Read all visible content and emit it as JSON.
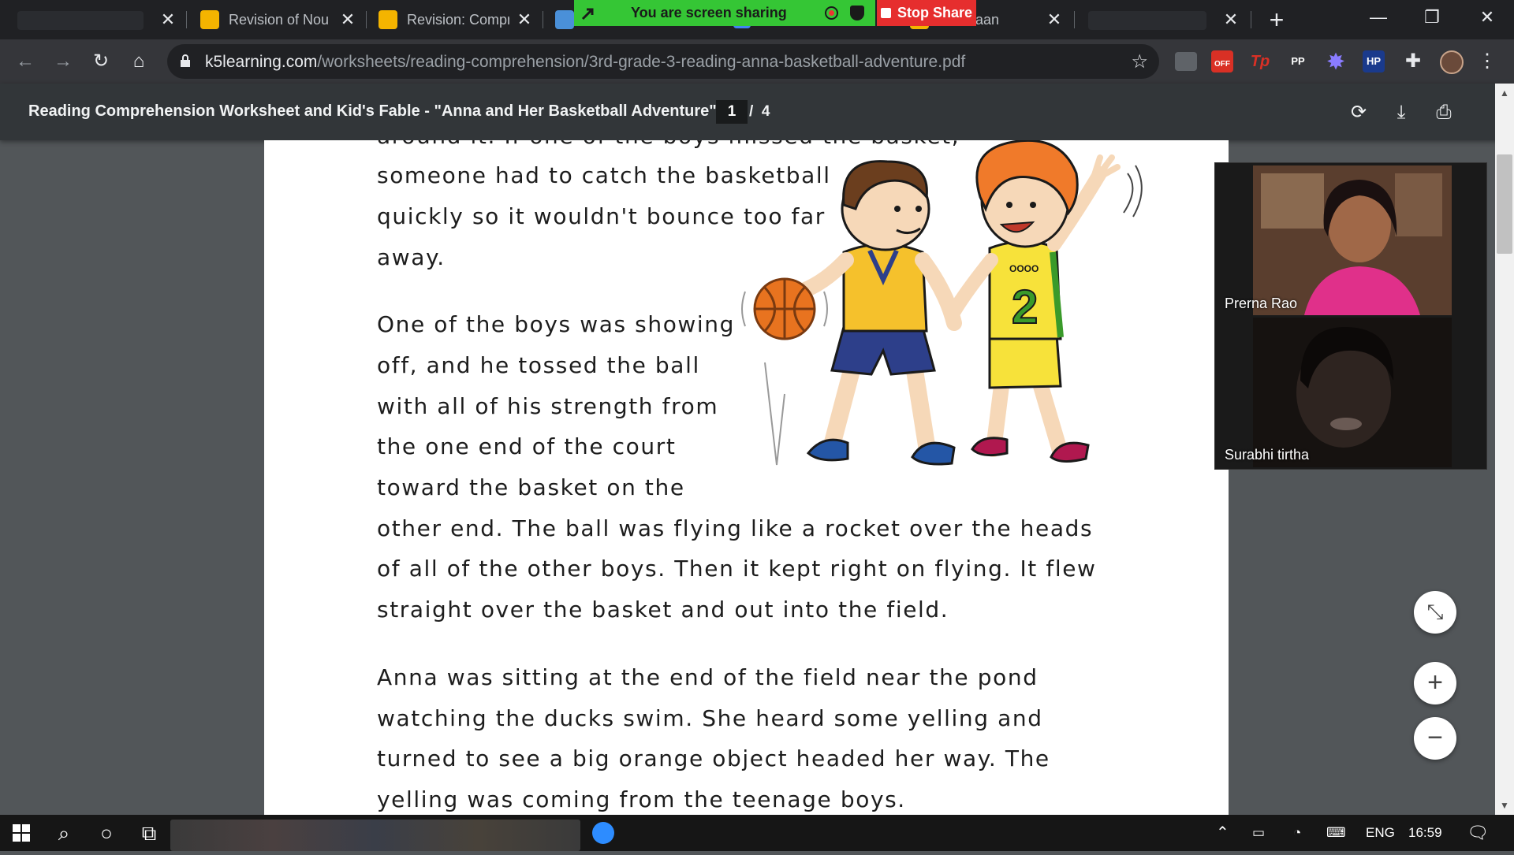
{
  "browser": {
    "tabs": [
      {
        "title": "",
        "favicon_color": "#2a2c30"
      },
      {
        "title": "Revision of Nou",
        "favicon_color": "#f4b400"
      },
      {
        "title": "Revision: Compr",
        "favicon_color": "#f4b400"
      },
      {
        "title": "",
        "favicon_color": "#4a90d9"
      },
      {
        "title": "",
        "favicon_color": "#4285f4"
      },
      {
        "title": "es - Baan",
        "favicon_color": "#f4b400"
      },
      {
        "title": "",
        "favicon_color": "#2a2c30"
      }
    ],
    "new_tab_symbol": "+",
    "url_host": "k5learning.com",
    "url_path": "/worksheets/reading-comprehension/3rd-grade-3-reading-anna-basketball-adventure.pdf",
    "extensions": [
      {
        "label": "",
        "color": "#5f6368"
      },
      {
        "label": "OFF",
        "color": "#d93025"
      },
      {
        "label": "Tp",
        "color": "#d93025"
      },
      {
        "label": "PP",
        "color": "#35363a"
      },
      {
        "label": "✸",
        "color": "#35363a"
      },
      {
        "label": "HP",
        "color": "#1a3a8c"
      }
    ]
  },
  "screen_share": {
    "message": "You are screen sharing",
    "stop_label": "Stop Share"
  },
  "pdf": {
    "title": "Reading Comprehension Worksheet and Kid's Fable - \"Anna and Her Basketball Adventure\"",
    "current_page": "1",
    "page_separator": "/",
    "total_pages": "4",
    "lines": [
      "around it. If one of the boys missed the basket,",
      "someone had to catch the basketball",
      "quickly so it wouldn't bounce too far",
      "away.",
      "One of the boys was showing",
      "off, and he tossed the ball",
      "with all of his strength from",
      "the one end of the court",
      "toward the basket on the",
      "other end. The ball was flying like a rocket over the heads",
      "of all of the other boys. Then it kept right on flying. It flew",
      "straight over the basket and out into the field.",
      "Anna was sitting at the end of the field near the pond",
      "watching the ducks swim. She heard some yelling and",
      "turned to see a big orange object headed her way. The",
      "yelling was coming from the teenage boys."
    ],
    "jersey_number": "2",
    "jersey_brand": "OOOO"
  },
  "zoom_controls": {
    "fit": "⤡",
    "zoom_in": "+",
    "zoom_out": "−"
  },
  "participants": [
    {
      "name": "Prerna Rao"
    },
    {
      "name": "Surabhi tirtha"
    }
  ],
  "taskbar": {
    "language": "ENG",
    "time": "16:59"
  }
}
